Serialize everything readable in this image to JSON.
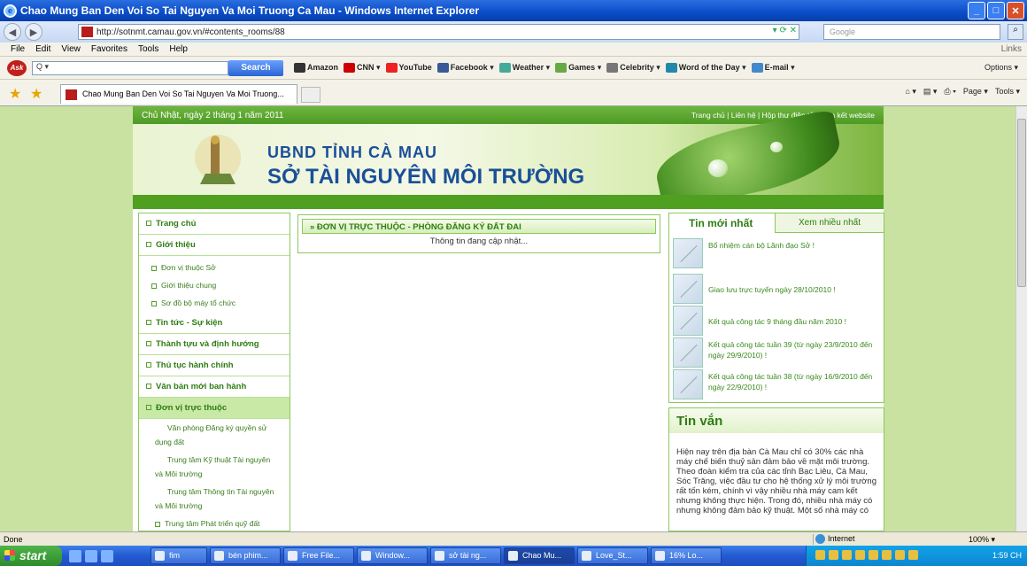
{
  "window": {
    "title": "Chao Mung Ban Den Voi So Tai Nguyen Va Moi Truong Ca Mau - Windows Internet Explorer",
    "url": "http://sotnmt.camau.gov.vn/#contents_rooms/88",
    "search_placeholder": "Google"
  },
  "menubar": {
    "items": [
      "File",
      "Edit",
      "View",
      "Favorites",
      "Tools",
      "Help"
    ],
    "links": "Links"
  },
  "toolbar": {
    "search_button": "Search",
    "links": [
      "Amazon",
      "CNN",
      "YouTube",
      "Facebook",
      "Weather",
      "Games",
      "Celebrity",
      "Word of the Day",
      "E-mail"
    ],
    "options": "Options"
  },
  "tab": {
    "title": "Chao Mung Ban Den Voi So Tai Nguyen Va Moi Truong...",
    "commands": [
      "Page",
      "Tools"
    ]
  },
  "site": {
    "date": "Chủ Nhật, ngày 2 tháng 1 năm 2011",
    "top_links": "Trang chủ  |  Liên hệ  |  Hộp thư điện tử  |  Liên kết website",
    "title_line1": "UBND TỈNH CÀ MAU",
    "title_line2": "SỞ TÀI NGUYÊN MÔI TRƯỜNG"
  },
  "nav": {
    "home": "Trang chủ",
    "intro": "Giới thiệu",
    "intro_sub": [
      "Đơn vị thuộc Sở",
      "Giới thiệu chung",
      "Sơ đồ bộ máy tổ chức"
    ],
    "news": "Tin tức - Sự kiện",
    "achievements": "Thành tựu và định hướng",
    "procedures": "Thủ tục hành chính",
    "documents": "Văn bản mới ban hành",
    "units": "Đơn vị trực thuộc",
    "units_sub": [
      "Văn phòng Đăng ký quyền sử dụng đất",
      "Trung tâm Kỹ thuật Tài nguyên và Môi trường",
      "Trung tâm Thông tin Tài nguyên và Môi trường",
      "Trung tâm Phát triển quỹ đất"
    ]
  },
  "center": {
    "breadcrumb": "» ĐƠN VỊ TRỰC THUỘC  -  PHÒNG ĐĂNG KÝ ĐẤT ĐAI",
    "body": "Thông tin đang cập nhật..."
  },
  "right": {
    "tab_latest": "Tin mới nhất",
    "tab_most_viewed": "Xem nhiều nhất",
    "news": [
      "Bổ nhiệm cán bộ Lãnh đạo Sở !",
      "Giao lưu trực tuyến ngày 28/10/2010 !",
      "Kết quả công tác 9 tháng đầu năm 2010 !",
      "Kết quả công tác tuần 39 (từ ngày 23/9/2010 đến ngày 29/9/2010) !",
      "Kết quả công tác tuần 38 (từ ngày 16/9/2010 đến ngày 22/9/2010) !"
    ],
    "brief_title": "Tin vắn",
    "brief_body": "Hiện nay trên địa bàn Cà Mau chỉ có 30% các nhà máy chế biến thuỷ sản đảm bảo về mặt môi trường. Theo đoàn kiểm tra của các tỉnh Bạc Liêu, Cà Mau, Sóc Trăng, việc đầu tư cho hệ thống xử lý môi trường rất tốn kém, chính vì vậy nhiều nhà máy cam kết nhưng không thực hiện. Trong đó, nhiều nhà máy có nhưng không đảm bảo kỹ thuật. Một số nhà máy có"
  },
  "status": {
    "text": "Done",
    "zone": "Internet",
    "zoom": "100%"
  },
  "taskbar": {
    "start": "start",
    "buttons": [
      "fim",
      "bén phim...",
      "Free File...",
      "Window...",
      "sở tài ng...",
      "Chao Mu...",
      "Love_St...",
      "16% Lo..."
    ],
    "clock": "1:59 CH"
  },
  "colors": {
    "accent_green": "#4fa020",
    "title_blue": "#1a4f99",
    "bg_green": "#c9e2a2"
  }
}
